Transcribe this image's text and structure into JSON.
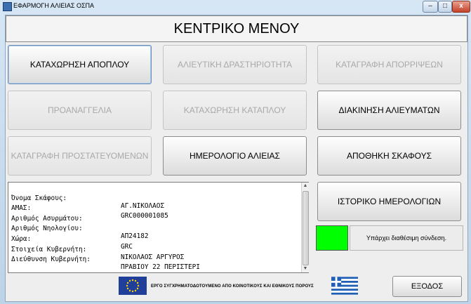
{
  "window": {
    "title": "ΕΦΑΡΜΟΓΗ ΑΛΙΕΙΑΣ ΟΣΠΑ",
    "controls": {
      "minimize": "–",
      "maximize": "□",
      "close": "x"
    }
  },
  "header": {
    "title": "ΚΕΝΤΡΙΚΟ ΜΕΝΟΥ"
  },
  "buttons": {
    "record_departure": "ΚΑΤΑΧΩΡΗΣΗ ΑΠΟΠΛΟΥ",
    "fishing_activity": "ΑΛΙΕΥΤΙΚΗ ΔΡΑΣΤΗΡΙΟΤΗΤΑ",
    "discards": "ΚΑΤΑΓΡΑΦΗ ΑΠΟΡΡΙΨΕΩΝ",
    "pre_notification": "ΠΡΟΑΝΑΓΓΕΛΙΑ",
    "record_arrival": "ΚΑΤΑΧΩΡΗΣΗ ΚΑΤΑΠΛΟΥ",
    "catch_transfer": "ΔΙΑΚΙΝΗΣΗ ΑΛΙΕΥΜΑΤΩΝ",
    "protected_species": "ΚΑΤΑΓΡΑΦΗ ΠΡΟΣΤΑΤΕΥΟΜΕΝΩΝ",
    "fishing_logbook": "ΗΜΕΡΟΛΟΓΙΟ ΑΛΙΕΙΑΣ",
    "store_vessel": "ΑΠΟΘΗΚΗ ΣΚΑΦΟΥΣ",
    "logbook_history": "ΙΣΤΟΡΙΚΟ ΗΜΕΡΟΛΟΓΙΩΝ",
    "exit": "ΕΞΟΔΟΣ"
  },
  "vessel_info": [
    {
      "label": "Όνομα Σκάφους:",
      "value": "ΑΓ.ΝΙΚΟΛΑΟΣ"
    },
    {
      "label": "ΑΜΑΣ:",
      "value": "GRC000001085"
    },
    {
      "label": "Αριθμός Ασυρμάτου:",
      "value": ""
    },
    {
      "label": "Αριθμός Νηολογίου:",
      "value": "ΑΠ24182"
    },
    {
      "label": "Χώρα:",
      "value": "GRC"
    },
    {
      "label": "Στοιχεία Κυβερνήτη:",
      "value": "ΝΙΚΟΛΑΟΣ ΑΡΓΥΡΟΣ"
    },
    {
      "label": "Διεύθυνση Κυβερνήτη:",
      "value": "ΠΡΑΒΙΟΥ 22 ΠΕΡΙΣΤΕΡΙ"
    }
  ],
  "status": {
    "connection_text": "Υπάρχει διαθέσιμη σύνδεση.",
    "indicator_color": "#00ff00"
  },
  "footer": {
    "funding_text": "ΕΡΓΟ ΣΥΓΧΡΗΜΑΤΟΔΟΤΟΥΜΕΝΟ ΑΠΟ ΚΟΙΝΟΤΙΚΟΥΣ ΚΑΙ ΕΘΝΙΚΟΥΣ ΠΟΡΟΥΣ",
    "eu_flag_icon": "eu-flag-icon",
    "greek_flag_icon": "greek-flag-icon"
  }
}
